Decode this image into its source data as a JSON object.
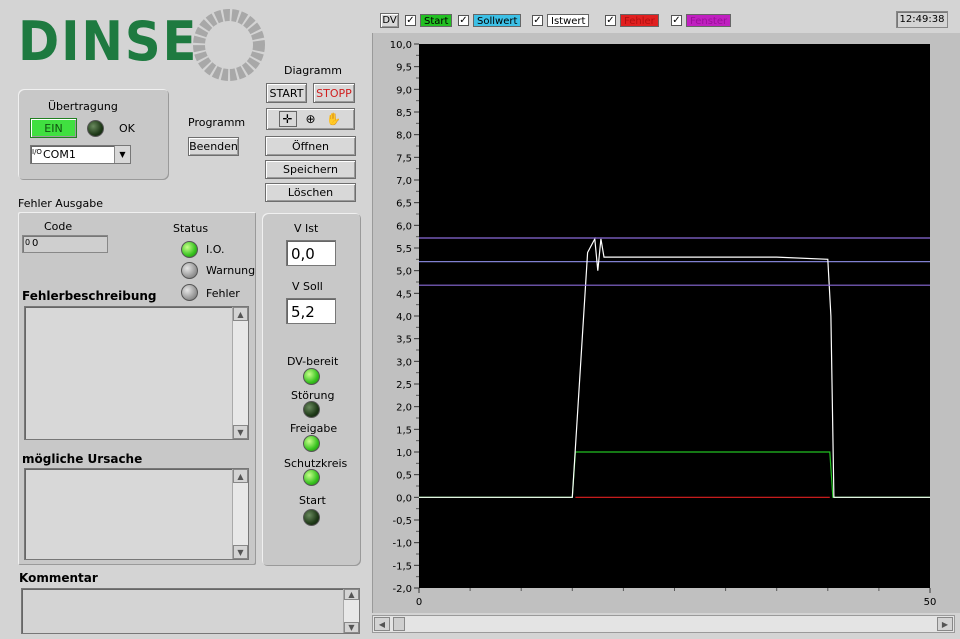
{
  "logo": {
    "text": "DINSE"
  },
  "uebertragung": {
    "title": "Übertragung",
    "button": "EIN",
    "status": "OK",
    "port_prefix": "I/O",
    "port": "COM1"
  },
  "programm": {
    "title": "Programm",
    "button": "Beenden"
  },
  "diagramm": {
    "title": "Diagramm",
    "start": "START",
    "stopp": "STOPP",
    "oeffnen": "Öffnen",
    "speichern": "Speichern",
    "loeschen": "Löschen"
  },
  "fehler": {
    "title": "Fehler Ausgabe",
    "code_label": "Code",
    "code_prefix": "0",
    "code_value": "0",
    "status_title": "Status",
    "status_items": [
      "I.O.",
      "Warnung",
      "Fehler"
    ],
    "beschreibung": "Fehlerbeschreibung",
    "ursache": "mögliche Ursache"
  },
  "kommentar": {
    "title": "Kommentar"
  },
  "values": {
    "v_ist_label": "V Ist",
    "v_ist": "0,0",
    "v_soll_label": "V Soll",
    "v_soll": "5,2",
    "indicators": [
      "DV-bereit",
      "Störung",
      "Freigabe",
      "Schutzkreis",
      "Start"
    ]
  },
  "legend": {
    "dv": "DV",
    "items": [
      {
        "label": "Start",
        "color": "#22c022"
      },
      {
        "label": "Sollwert",
        "color": "#3cc0e6"
      },
      {
        "label": "Istwert",
        "color": "#ffffff"
      },
      {
        "label": "Fehler",
        "color": "#e02020"
      },
      {
        "label": "Fenster",
        "color": "#c020c0"
      }
    ]
  },
  "clock": "12:49:38",
  "chart_data": {
    "type": "line",
    "xlim": [
      0,
      50
    ],
    "ylim": [
      -2.0,
      10.0
    ],
    "x_ticks": [
      "0",
      "50"
    ],
    "y_ticks": [
      "10,0",
      "9,5",
      "9,0",
      "8,5",
      "8,0",
      "7,5",
      "7,0",
      "6,5",
      "6,0",
      "5,5",
      "5,0",
      "4,5",
      "4,0",
      "3,5",
      "3,0",
      "2,5",
      "2,0",
      "1,5",
      "1,0",
      "0,5",
      "0,0",
      "-0,5",
      "-1,0",
      "-1,5",
      "-2,0"
    ],
    "series": [
      {
        "name": "Start",
        "color": "#22c022",
        "points": [
          [
            0,
            0
          ],
          [
            15,
            0
          ],
          [
            15.3,
            1.0
          ],
          [
            40.2,
            1.0
          ],
          [
            40.5,
            0
          ],
          [
            50,
            0
          ]
        ]
      },
      {
        "name": "Sollwert",
        "color": "#8080d0",
        "points": [
          [
            0,
            5.2
          ],
          [
            50,
            5.2
          ]
        ]
      },
      {
        "name": "Istwert",
        "color": "#ffffff",
        "points": [
          [
            0,
            0
          ],
          [
            15,
            0
          ],
          [
            16.5,
            5.4
          ],
          [
            17.2,
            5.7
          ],
          [
            17.5,
            5.0
          ],
          [
            17.8,
            5.7
          ],
          [
            18.1,
            5.3
          ],
          [
            20,
            5.3
          ],
          [
            25,
            5.3
          ],
          [
            30,
            5.3
          ],
          [
            35,
            5.3
          ],
          [
            40,
            5.25
          ],
          [
            40.3,
            4.0
          ],
          [
            40.6,
            0
          ],
          [
            50,
            0
          ]
        ]
      },
      {
        "name": "Fehler",
        "color": "#e02020",
        "points": [
          [
            15.3,
            0
          ],
          [
            40.2,
            0
          ]
        ]
      },
      {
        "name": "Fenster oben",
        "color": "#8a6ad8",
        "points": [
          [
            0,
            5.72
          ],
          [
            50,
            5.72
          ]
        ]
      },
      {
        "name": "Fenster unten",
        "color": "#8a6ad8",
        "points": [
          [
            0,
            4.68
          ],
          [
            50,
            4.68
          ]
        ]
      }
    ]
  }
}
